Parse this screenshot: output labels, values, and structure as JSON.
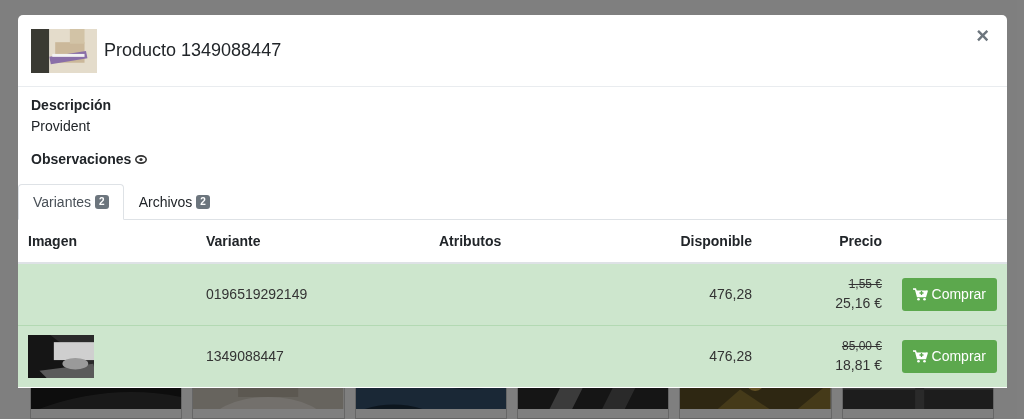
{
  "modal": {
    "title": "Producto 1349088447",
    "close": "×"
  },
  "description": {
    "label": "Descripción",
    "value": "Provident"
  },
  "observations": {
    "label": "Observaciones"
  },
  "tabs": [
    {
      "label": "Variantes",
      "count": "2",
      "selected": true
    },
    {
      "label": "Archivos",
      "count": "2",
      "selected": false
    }
  ],
  "table": {
    "columns": [
      "Imagen",
      "Variante",
      "Atributos",
      "Disponible",
      "Precio"
    ],
    "rows": [
      {
        "variant": "0196519292149",
        "available": "476,28",
        "old_price": "1,55 €",
        "price": "25,16 €",
        "button": "Comprar"
      },
      {
        "variant": "1349088447",
        "available": "476,28",
        "old_price": "85,00 €",
        "price": "18,81 €",
        "button": "Comprar"
      }
    ]
  }
}
